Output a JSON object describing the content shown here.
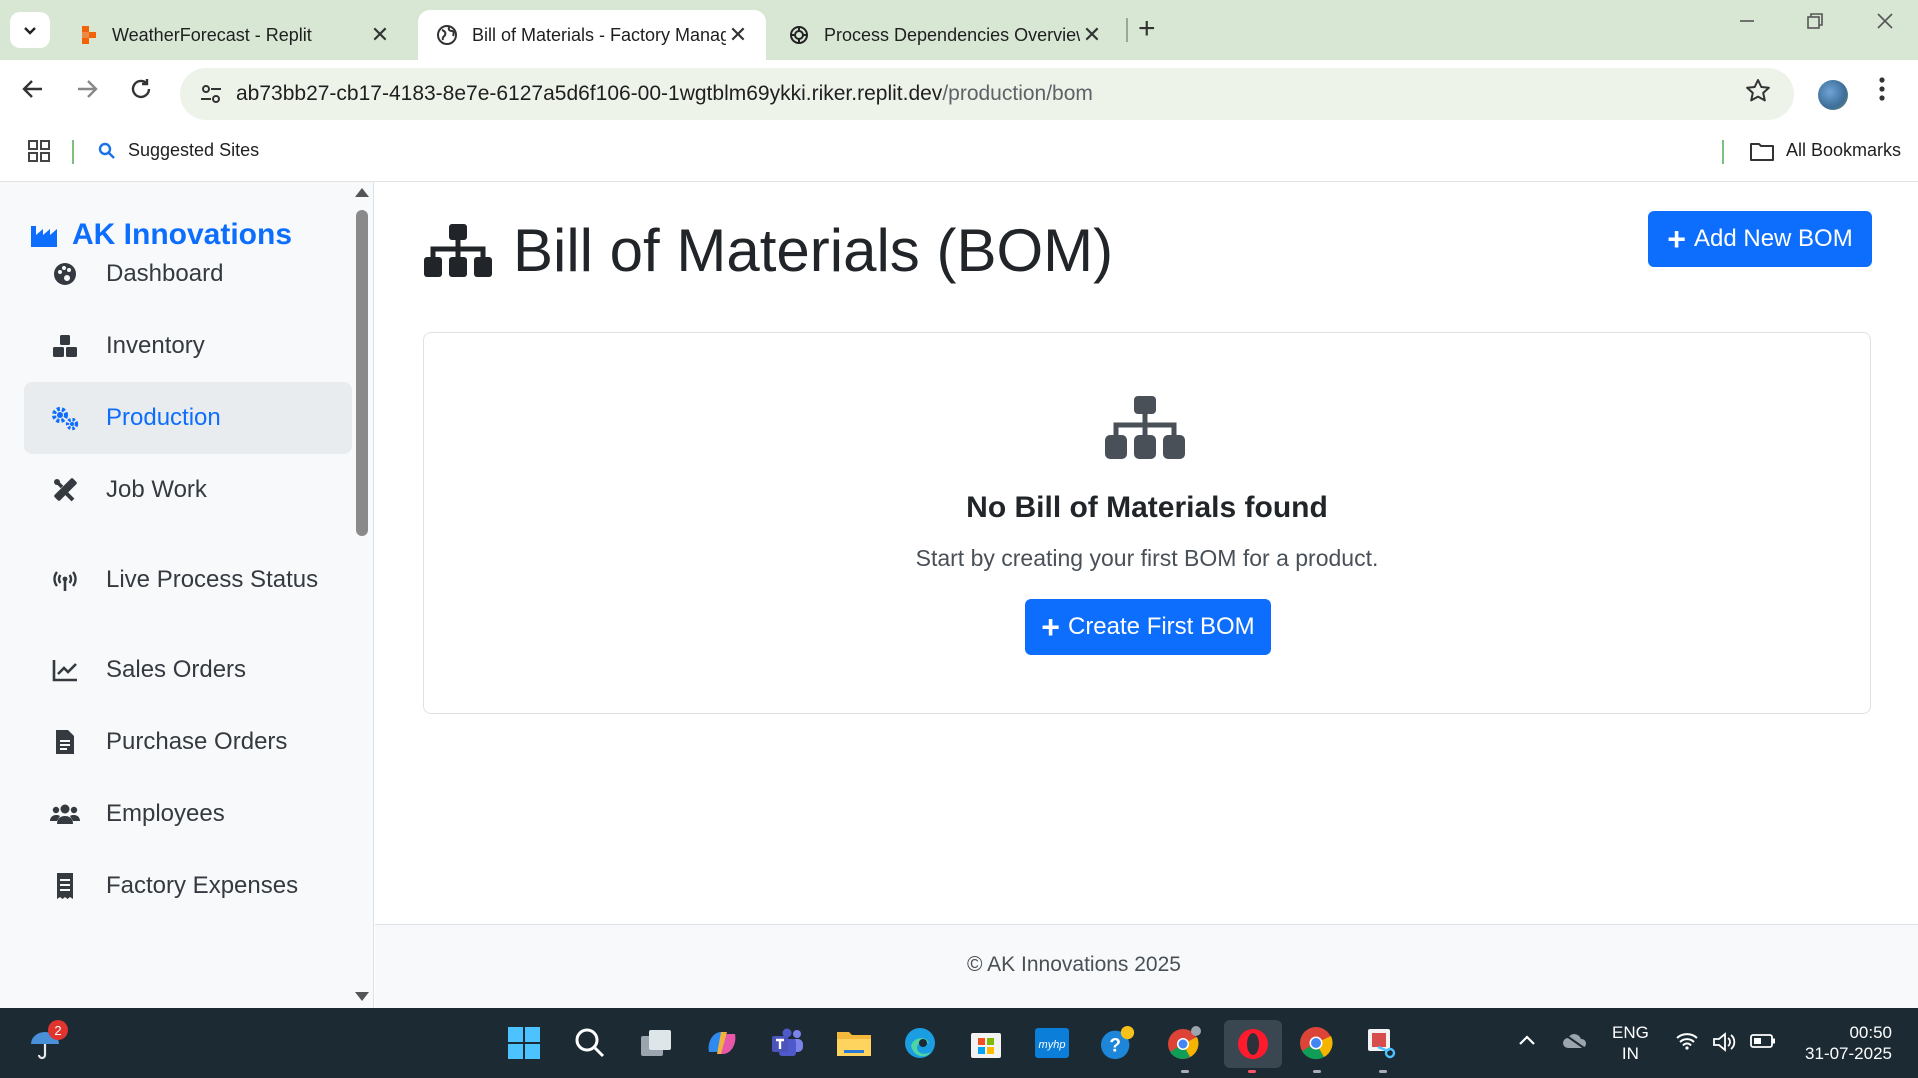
{
  "browser": {
    "tabs": [
      {
        "title": "WeatherForecast - Replit",
        "close": "✕"
      },
      {
        "title": "Bill of Materials - Factory Management",
        "close": "✕"
      },
      {
        "title": "Process Dependencies Overview",
        "close": "✕"
      }
    ],
    "new_tab": "+",
    "url_host": "ab73bb27-cb17-4183-8e7e-6127a5d6f106-00-1wgtblm69ykki.riker.replit.dev",
    "url_path": "/production/bom",
    "bookmarks": {
      "suggested": "Suggested Sites",
      "all": "All Bookmarks"
    },
    "colors": {
      "tabstrip": "#d8e6d4",
      "omnibox": "#eef3ea"
    }
  },
  "app": {
    "brand": "AK Innovations",
    "colors": {
      "primary": "#0d6efd",
      "sidebar_bg": "#f8f9fa",
      "text": "#212529"
    },
    "sidebar": {
      "items": [
        {
          "label": "Dashboard",
          "icon": "palette-icon"
        },
        {
          "label": "Inventory",
          "icon": "boxes-icon"
        },
        {
          "label": "Production",
          "icon": "gears-icon",
          "active": true
        },
        {
          "label": "Job Work",
          "icon": "tools-icon"
        },
        {
          "label": "Live Process Status",
          "icon": "broadcast-icon"
        },
        {
          "label": "Sales Orders",
          "icon": "chart-line-icon"
        },
        {
          "label": "Purchase Orders",
          "icon": "file-invoice-icon"
        },
        {
          "label": "Employees",
          "icon": "users-icon"
        },
        {
          "label": "Factory Expenses",
          "icon": "receipt-icon"
        }
      ]
    },
    "page": {
      "title": "Bill of Materials (BOM)",
      "add_button": "Add New BOM",
      "empty_title": "No Bill of Materials found",
      "empty_subtitle": "Start by creating your first BOM for a product.",
      "create_button": "Create First BOM"
    },
    "footer": "© AK Innovations 2025"
  },
  "taskbar": {
    "weather_badge": "2",
    "lang_line1": "ENG",
    "lang_line2": "IN",
    "time": "00:50",
    "date": "31-07-2025"
  }
}
